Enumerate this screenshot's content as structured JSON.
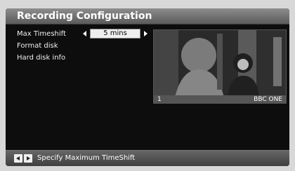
{
  "title": "Recording Configuration",
  "menu": {
    "items": [
      {
        "label": "Max Timeshift",
        "value": "5 mins",
        "selected": true
      },
      {
        "label": "Format disk"
      },
      {
        "label": "Hard disk info"
      }
    ]
  },
  "preview": {
    "channel_number": "1",
    "channel_name": "BBC ONE"
  },
  "footer": {
    "hint": "Specify Maximum TimeShift",
    "icons": [
      "left-arrow-key-icon",
      "right-arrow-key-icon"
    ]
  },
  "colors": {
    "background": "#0d0d0d",
    "title_bar": "#777777",
    "field": "#efefef",
    "text": "#f0f0f0"
  }
}
